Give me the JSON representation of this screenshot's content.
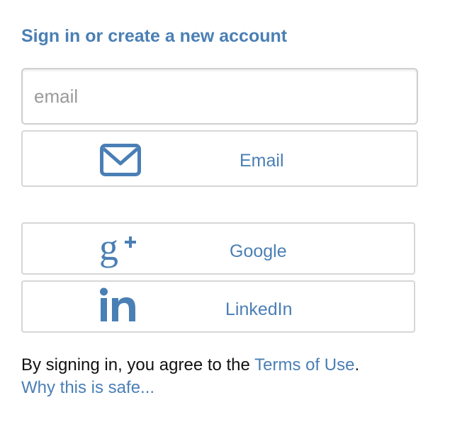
{
  "title": "Sign in or create a new account",
  "email_input": {
    "placeholder": "email",
    "value": ""
  },
  "buttons": {
    "email": {
      "label": "Email",
      "icon": "envelope-icon"
    },
    "google": {
      "label": "Google",
      "icon": "google-plus-icon"
    },
    "linkedin": {
      "label": "LinkedIn",
      "icon": "linkedin-icon"
    }
  },
  "footer": {
    "prefix": "By signing in, you agree to the ",
    "terms_link": "Terms of Use",
    "suffix": ".",
    "safe_link": "Why this is safe..."
  },
  "colors": {
    "accent": "#4a7fb5",
    "border": "#d6d6d6",
    "text": "#111111"
  }
}
